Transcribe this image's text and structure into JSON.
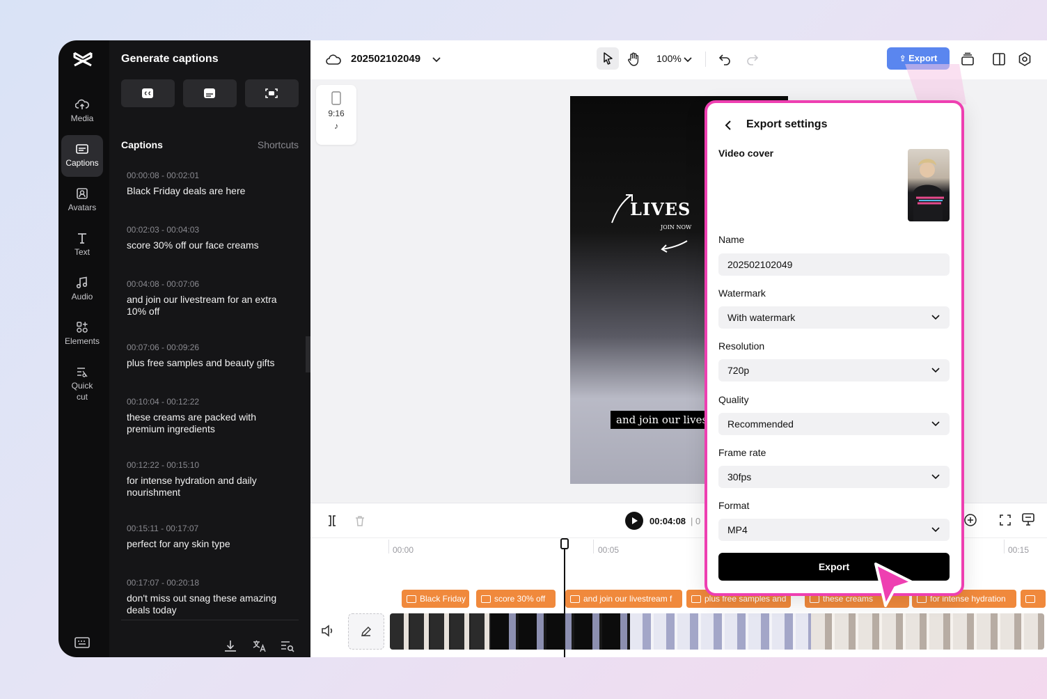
{
  "nav": {
    "items": [
      {
        "label": "Media",
        "icon": "cloud-upload-icon"
      },
      {
        "label": "Captions",
        "icon": "captions-icon",
        "active": true
      },
      {
        "label": "Avatars",
        "icon": "avatar-icon"
      },
      {
        "label": "Text",
        "icon": "text-icon"
      },
      {
        "label": "Audio",
        "icon": "music-icon"
      },
      {
        "label": "Elements",
        "icon": "elements-icon"
      },
      {
        "label": "Quick cut",
        "icon": "quick-cut-icon"
      }
    ]
  },
  "captions_panel": {
    "title": "Generate captions",
    "section_title": "Captions",
    "shortcuts_label": "Shortcuts",
    "items": [
      {
        "time": "00:00:08 - 00:02:01",
        "text": "Black Friday deals are here"
      },
      {
        "time": "00:02:03 - 00:04:03",
        "text": "score 30% off our face creams"
      },
      {
        "time": "00:04:08 - 00:07:06",
        "text": "and join our livestream for an extra 10% off"
      },
      {
        "time": "00:07:06 - 00:09:26",
        "text": "plus free samples and beauty gifts"
      },
      {
        "time": "00:10:04 - 00:12:22",
        "text": "these creams are packed with premium ingredients"
      },
      {
        "time": "00:12:22 - 00:15:10",
        "text": "for intense hydration and daily nourishment"
      },
      {
        "time": "00:15:11 - 00:17:07",
        "text": "perfect for any skin type"
      },
      {
        "time": "00:17:07 - 00:20:18",
        "text": "don't miss out snag these amazing deals today"
      }
    ]
  },
  "topbar": {
    "project_name": "202502102049",
    "zoom": "100%",
    "export_label": "Export"
  },
  "canvas": {
    "ratio_label": "9:16",
    "video_heading": "LIVES",
    "video_small": "JOIN NOW",
    "video_subtitle": "and join our lives"
  },
  "timeline": {
    "current_time": "00:04:08",
    "time_divider": "| 0",
    "ruler": [
      "00:00",
      "00:05",
      "00:15"
    ],
    "caption_clips": [
      "Black Friday",
      "score 30% off",
      "and join our livestream f",
      "plus free samples and",
      "these creams",
      "for intense hydration",
      ""
    ]
  },
  "export_settings": {
    "title": "Export settings",
    "video_cover_label": "Video cover",
    "name_label": "Name",
    "name_value": "202502102049",
    "watermark_label": "Watermark",
    "watermark_value": "With watermark",
    "resolution_label": "Resolution",
    "resolution_value": "720p",
    "quality_label": "Quality",
    "quality_value": "Recommended",
    "framerate_label": "Frame rate",
    "framerate_value": "30fps",
    "format_label": "Format",
    "format_value": "MP4",
    "export_button": "Export"
  },
  "colors": {
    "accent": "#5a86ef",
    "highlight_border": "#ee3fb1",
    "caption_clip": "#f0893c",
    "panel_bg": "#151517"
  }
}
